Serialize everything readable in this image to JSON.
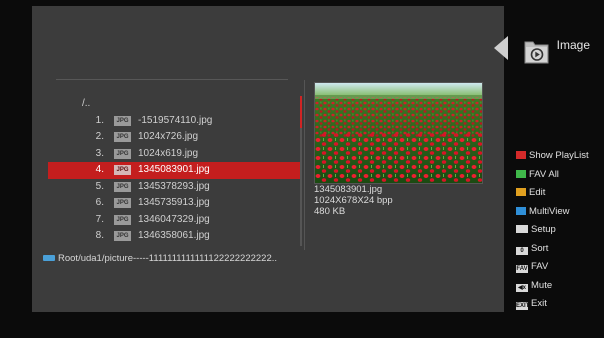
{
  "header": {
    "title": "Image",
    "icon": "image-player-icon"
  },
  "file_list": {
    "parent": "/..",
    "items": [
      {
        "index": "1.",
        "type": "JPG",
        "name": "-1519574110.jpg",
        "selected": false
      },
      {
        "index": "2.",
        "type": "JPG",
        "name": "1024x726.jpg",
        "selected": false
      },
      {
        "index": "3.",
        "type": "JPG",
        "name": "1024x619.jpg",
        "selected": false
      },
      {
        "index": "4.",
        "type": "JPG",
        "name": "1345083901.jpg",
        "selected": true
      },
      {
        "index": "5.",
        "type": "JPG",
        "name": "1345378293.jpg",
        "selected": false
      },
      {
        "index": "6.",
        "type": "JPG",
        "name": "1345735913.jpg",
        "selected": false
      },
      {
        "index": "7.",
        "type": "JPG",
        "name": "1346047329.jpg",
        "selected": false
      },
      {
        "index": "8.",
        "type": "JPG",
        "name": "1346358061.jpg",
        "selected": false
      }
    ]
  },
  "path": "Root/uda1/picture-----1111111111111122222222222..",
  "preview_info": {
    "filename": "1345083901.jpg",
    "dimensions": "1024X678X24 bpp",
    "size": "480 KB"
  },
  "legend": [
    {
      "kind": "color",
      "color": "#d42a2a",
      "label": "Show PlayList"
    },
    {
      "kind": "color",
      "color": "#3fb84a",
      "label": "FAV All"
    },
    {
      "kind": "color",
      "color": "#e0a020",
      "label": "Edit"
    },
    {
      "kind": "color",
      "color": "#2f8fd8",
      "label": "MultiView"
    },
    {
      "kind": "key",
      "key": "",
      "label": "Setup"
    },
    {
      "kind": "key",
      "key": "0",
      "label": "Sort"
    },
    {
      "kind": "key",
      "key": "FAV",
      "label": "FAV"
    },
    {
      "kind": "key",
      "key": "◀x",
      "label": "Mute"
    },
    {
      "kind": "key",
      "key": "EXIT",
      "label": "Exit"
    }
  ],
  "colors": {
    "selection": "#c41e1e",
    "panel": "#3c3c3c",
    "background": "#0b0b0b"
  }
}
